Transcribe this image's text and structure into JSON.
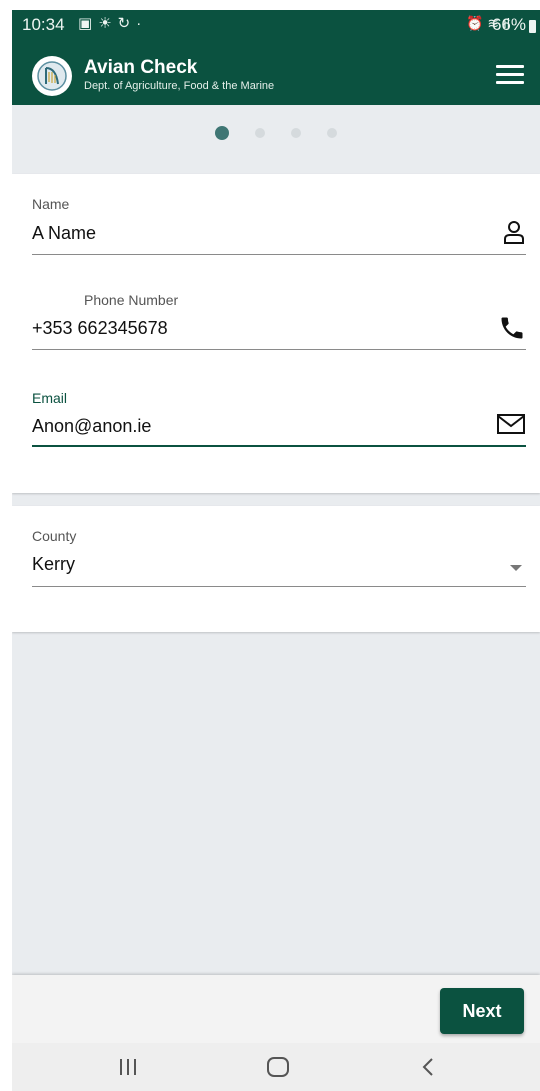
{
  "status_bar": {
    "time": "10:34",
    "battery": "66%",
    "left_icons": [
      "image-icon",
      "weather-icon",
      "sync-icon"
    ],
    "right_icons": [
      "alarm-icon",
      "wifi-icon",
      "signal-icon"
    ]
  },
  "app": {
    "title": "Avian Check",
    "subtitle": "Dept. of Agriculture, Food & the Marine",
    "header_color": "#0b5240",
    "logo_icon": "harp-icon"
  },
  "stepper": {
    "total_steps": 4,
    "current_step": 1
  },
  "form": {
    "name": {
      "label": "Name",
      "value": "A Name",
      "icon": "person-icon"
    },
    "phone": {
      "label": "Phone Number",
      "value": "+353 662345678",
      "icon": "phone-icon"
    },
    "email": {
      "label": "Email",
      "value": "Anon@anon.ie",
      "icon": "mail-icon",
      "focused": true
    },
    "county": {
      "label": "County",
      "value": "Kerry",
      "icon": "dropdown-arrow-icon"
    }
  },
  "actions": {
    "next_label": "Next"
  },
  "system_nav": {
    "buttons": [
      "recent-apps-icon",
      "home-icon",
      "back-icon"
    ]
  },
  "colors": {
    "accent": "#0b5240",
    "step_active": "#3f7674",
    "step_inactive": "#d5dadd",
    "background": "#e9ecef"
  }
}
